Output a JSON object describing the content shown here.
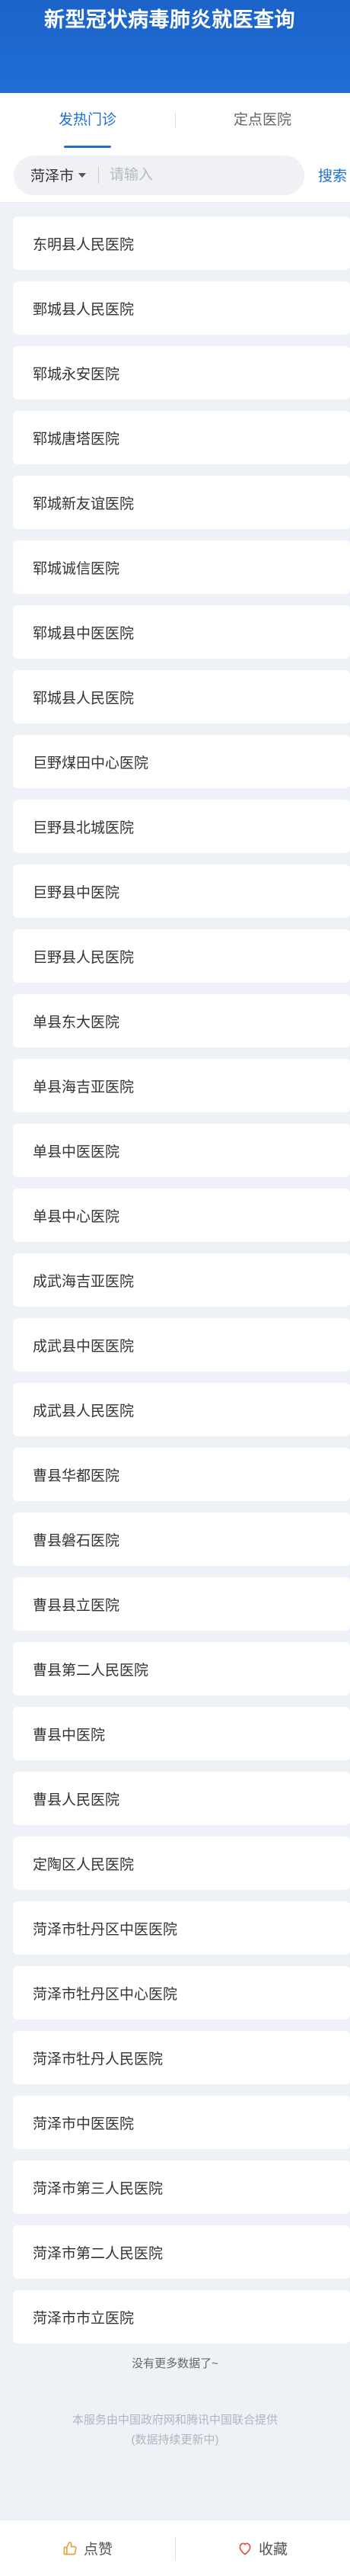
{
  "header": {
    "title": "新型冠状病毒肺炎就医查询"
  },
  "tabs": [
    {
      "label": "发热门诊"
    },
    {
      "label": "定点医院"
    }
  ],
  "search": {
    "city": "菏泽市",
    "placeholder": "请输入",
    "button_label": "搜索"
  },
  "hospitals": [
    "东明县人民医院",
    "鄄城县人民医院",
    "郓城永安医院",
    "郓城唐塔医院",
    "郓城新友谊医院",
    "郓城诚信医院",
    "郓城县中医医院",
    "郓城县人民医院",
    "巨野煤田中心医院",
    "巨野县北城医院",
    "巨野县中医院",
    "巨野县人民医院",
    "单县东大医院",
    "单县海吉亚医院",
    "单县中医医院",
    "单县中心医院",
    "成武海吉亚医院",
    "成武县中医医院",
    "成武县人民医院",
    "曹县华都医院",
    "曹县磐石医院",
    "曹县县立医院",
    "曹县第二人民医院",
    "曹县中医院",
    "曹县人民医院",
    "定陶区人民医院",
    "菏泽市牡丹区中医医院",
    "菏泽市牡丹区中心医院",
    "菏泽市牡丹人民医院",
    "菏泽市中医医院",
    "菏泽市第三人民医院",
    "菏泽市第二人民医院",
    "菏泽市市立医院"
  ],
  "more_text": "没有更多数据了~",
  "footer": {
    "line1": "本服务由中国政府网和腾讯中国联合提供",
    "line2": "(数据持续更新中)"
  },
  "bottom_bar": {
    "like_label": "点赞",
    "like_icon": "thumbs-up-icon",
    "fav_label": "收藏",
    "fav_icon": "heart-icon",
    "like_color": "#e8a33d",
    "fav_color": "#e04a4a"
  },
  "colors": {
    "brand": "#1f6fd6",
    "background": "#eef2f6"
  }
}
